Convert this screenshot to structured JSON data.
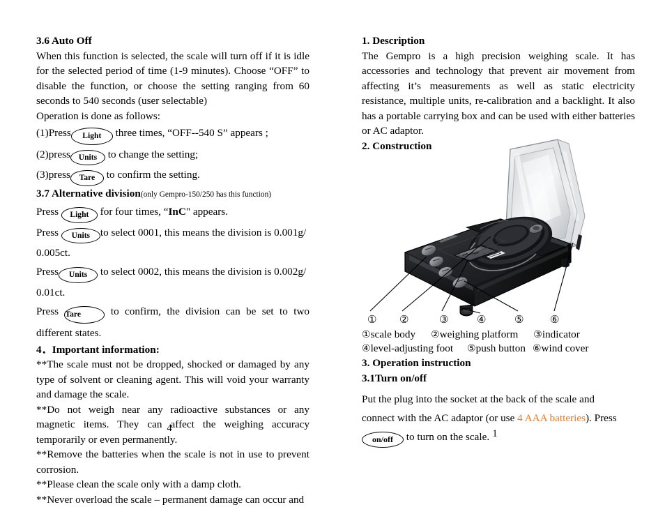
{
  "document": {
    "left_page_number": "4",
    "right_page_number": "1",
    "accent_color": "#ee7a1c"
  },
  "left_column": {
    "section_3_6": {
      "heading": "3.6 Auto Off",
      "body": "When this function is selected, the scale will turn off if it is idle for the selected period of time (1-9 minutes). Choose “OFF” to disable the function, or choose the setting ranging from 60 seconds to 540 seconds (user selectable)",
      "operation_intro": "Operation is done as follows:",
      "steps": [
        {
          "prefix": "(1)Press",
          "key": "Light",
          "suffix": "three times, “OFF--540 S” appears ;"
        },
        {
          "prefix": "(2)press",
          "key": "Units",
          "suffix": "to change the setting;"
        },
        {
          "prefix": "(3)press",
          "key": "Tare",
          "suffix": "to confirm the setting."
        }
      ]
    },
    "section_3_7": {
      "heading": "3.7 Alternative division",
      "heading_note": "(only Gempro-150/250 has this function)",
      "line1_prefix": "Press",
      "line1_key": "Light",
      "line1_mid": "for four times, “",
      "line1_bold": "InC",
      "line1_suffix": "\" appears.",
      "line2_prefix": "Press",
      "line2_key": "Units",
      "line2_suffix": "to select 0001, this means the division is 0.001g/ 0.005ct.",
      "line3_prefix": "Press",
      "line3_key": "Units",
      "line3_suffix": "to select 0002, this means the division is 0.002g/ 0.01ct.",
      "line4_prefix": "Press",
      "line4_key": "Tare",
      "line4_suffix": "to confirm, the division can be set to two different states."
    },
    "section_4": {
      "heading": "4．Important information:",
      "items": [
        "**The scale must not be dropped, shocked or damaged by any type of solvent or cleaning agent.   This will void your warranty and damage the scale.",
        "**Do not weigh near any radioactive substances or any magnetic items.   They can affect the weighing accuracy temporarily or even permanently.",
        "**Remove the batteries when the scale is not in use to prevent corrosion.",
        "**Please clean the scale only with a damp cloth.",
        "**Never overload the scale – permanent damage can occur and"
      ]
    }
  },
  "right_column": {
    "section_1": {
      "heading": "1. Description",
      "body": "The Gempro is a high precision weighing scale. It has accessories and technology that prevent air movement from affecting it’s measurements as well as static electricity resistance, multiple units, re-calibration and a backlight. It also has a portable carrying box and can be used with either batteries or AC adaptor."
    },
    "section_2": {
      "heading": "2. Construction",
      "figure_alt": "photograph of a black digital precision jewellery scale with an open transparent wind cover",
      "callouts": [
        "①",
        "②",
        "③",
        "④",
        "⑤",
        "⑥"
      ],
      "legend_row_1": [
        {
          "num": "①",
          "label": "scale body"
        },
        {
          "num": "②",
          "label": "weighing platform"
        },
        {
          "num": "③",
          "label": "indicator"
        }
      ],
      "legend_row_2": [
        {
          "num": "④",
          "label": "level-adjusting foot"
        },
        {
          "num": "⑤",
          "label": "push button"
        },
        {
          "num": "⑥",
          "label": "wind cover"
        }
      ]
    },
    "section_3": {
      "heading": "3. Operation instruction",
      "sub_heading": "3.1Turn on/off",
      "para1": "Put the plug into the socket at the back of the scale and",
      "para2_pre": "connect with the AC adaptor (or use ",
      "para2_accent": "4 AAA batteries",
      "para2_post": "). Press",
      "key": "on/off",
      "para3": "to turn on the scale."
    }
  }
}
